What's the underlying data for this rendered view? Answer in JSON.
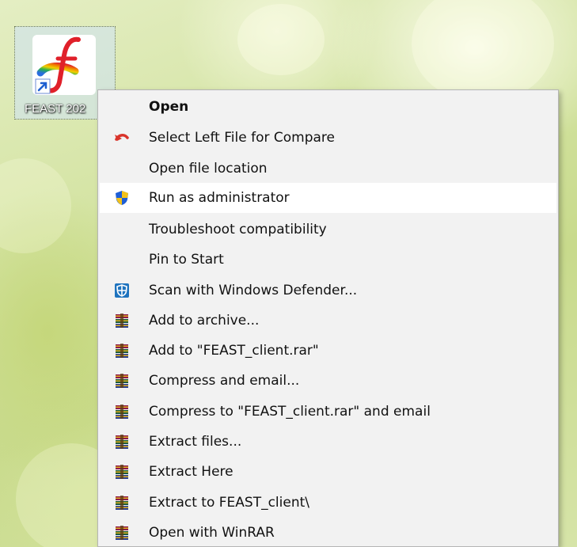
{
  "desktop": {
    "icon_label": "FEAST 202"
  },
  "menu": {
    "items": [
      {
        "label": "Open",
        "icon": null,
        "bold": true
      },
      {
        "label": "Select Left File for Compare",
        "icon": "undo-arrow-icon"
      },
      {
        "label": "Open file location",
        "icon": null
      },
      {
        "label": "Run as administrator",
        "icon": "uac-shield-icon",
        "highlighted": true
      },
      {
        "label": "Troubleshoot compatibility",
        "icon": null
      },
      {
        "label": "Pin to Start",
        "icon": null
      },
      {
        "label": "Scan with Windows Defender...",
        "icon": "defender-icon"
      },
      {
        "label": "Add to archive...",
        "icon": "winrar-icon"
      },
      {
        "label": "Add to \"FEAST_client.rar\"",
        "icon": "winrar-icon"
      },
      {
        "label": "Compress and email...",
        "icon": "winrar-icon"
      },
      {
        "label": "Compress to \"FEAST_client.rar\" and email",
        "icon": "winrar-icon"
      },
      {
        "label": "Extract files...",
        "icon": "winrar-icon"
      },
      {
        "label": "Extract Here",
        "icon": "winrar-icon"
      },
      {
        "label": "Extract to FEAST_client\\",
        "icon": "winrar-icon"
      },
      {
        "label": "Open with WinRAR",
        "icon": "winrar-icon"
      }
    ]
  },
  "colors": {
    "menu_background": "#f2f2f2",
    "highlight": "#ffffff",
    "undo_arrow": "#d9342b",
    "defender_blue": "#1e73be"
  }
}
